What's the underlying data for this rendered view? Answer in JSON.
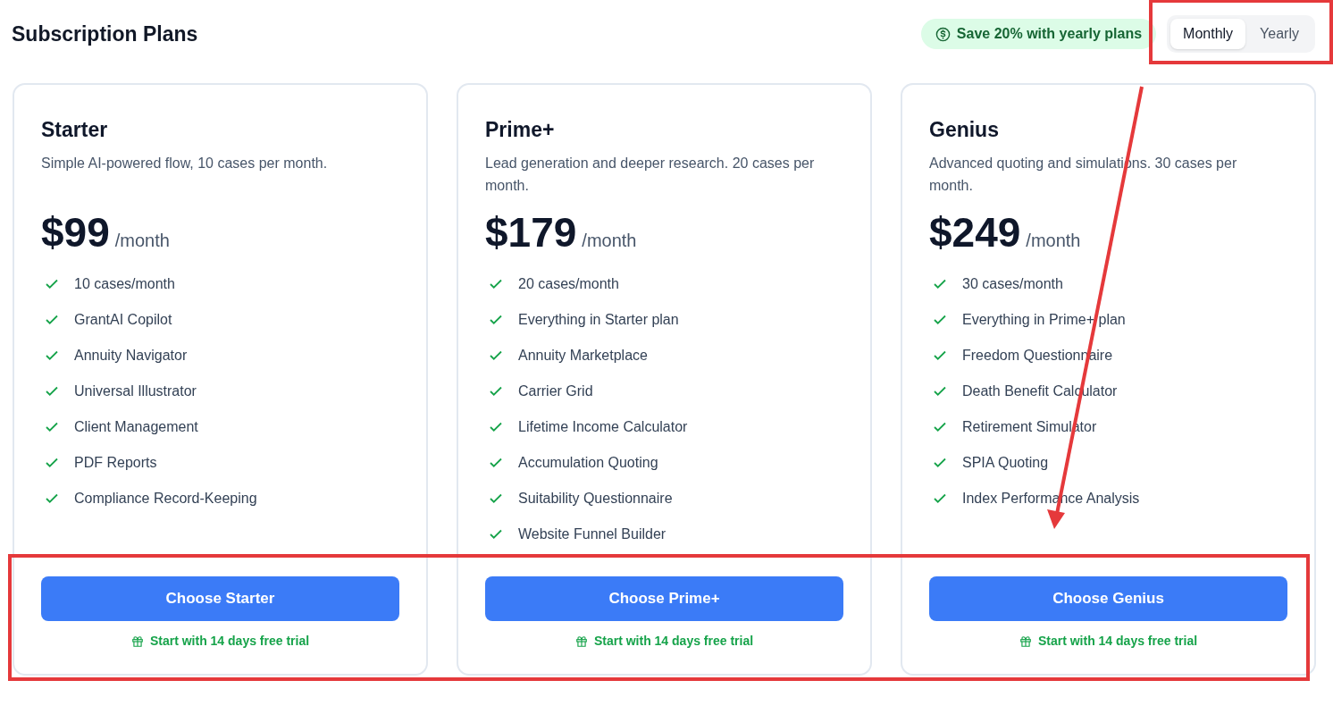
{
  "page_title": "Subscription Plans",
  "savings_badge": "Save 20% with yearly plans",
  "billing_toggle": [
    {
      "label": "Monthly",
      "selected": true
    },
    {
      "label": "Yearly",
      "selected": false
    }
  ],
  "plans": [
    {
      "name": "Starter",
      "description": "Simple AI-powered flow, 10 cases per month.",
      "price": "$99",
      "period": "/month",
      "features": [
        "10 cases/month",
        "GrantAI Copilot",
        "Annuity Navigator",
        "Universal Illustrator",
        "Client Management",
        "PDF Reports",
        "Compliance Record-Keeping"
      ],
      "button": "Choose Starter",
      "trial": "Start with 14 days free trial"
    },
    {
      "name": "Prime+",
      "description": "Lead generation and deeper research. 20 cases per month.",
      "price": "$179",
      "period": "/month",
      "features": [
        "20 cases/month",
        "Everything in Starter plan",
        "Annuity Marketplace",
        "Carrier Grid",
        "Lifetime Income Calculator",
        "Accumulation Quoting",
        "Suitability Questionnaire",
        "Website Funnel Builder"
      ],
      "button": "Choose Prime+",
      "trial": "Start with 14 days free trial"
    },
    {
      "name": "Genius",
      "description": "Advanced quoting and simulations. 30 cases per month.",
      "price": "$249",
      "period": "/month",
      "features": [
        "30 cases/month",
        "Everything in Prime+ plan",
        "Freedom Questionnaire",
        "Death Benefit Calculator",
        "Retirement Simulator",
        "SPIA Quoting",
        "Index Performance Analysis"
      ],
      "button": "Choose Genius",
      "trial": "Start with 14 days free trial"
    }
  ],
  "annotations": [
    {
      "kind": "box"
    },
    {
      "kind": "box"
    },
    {
      "kind": "arrow"
    }
  ]
}
